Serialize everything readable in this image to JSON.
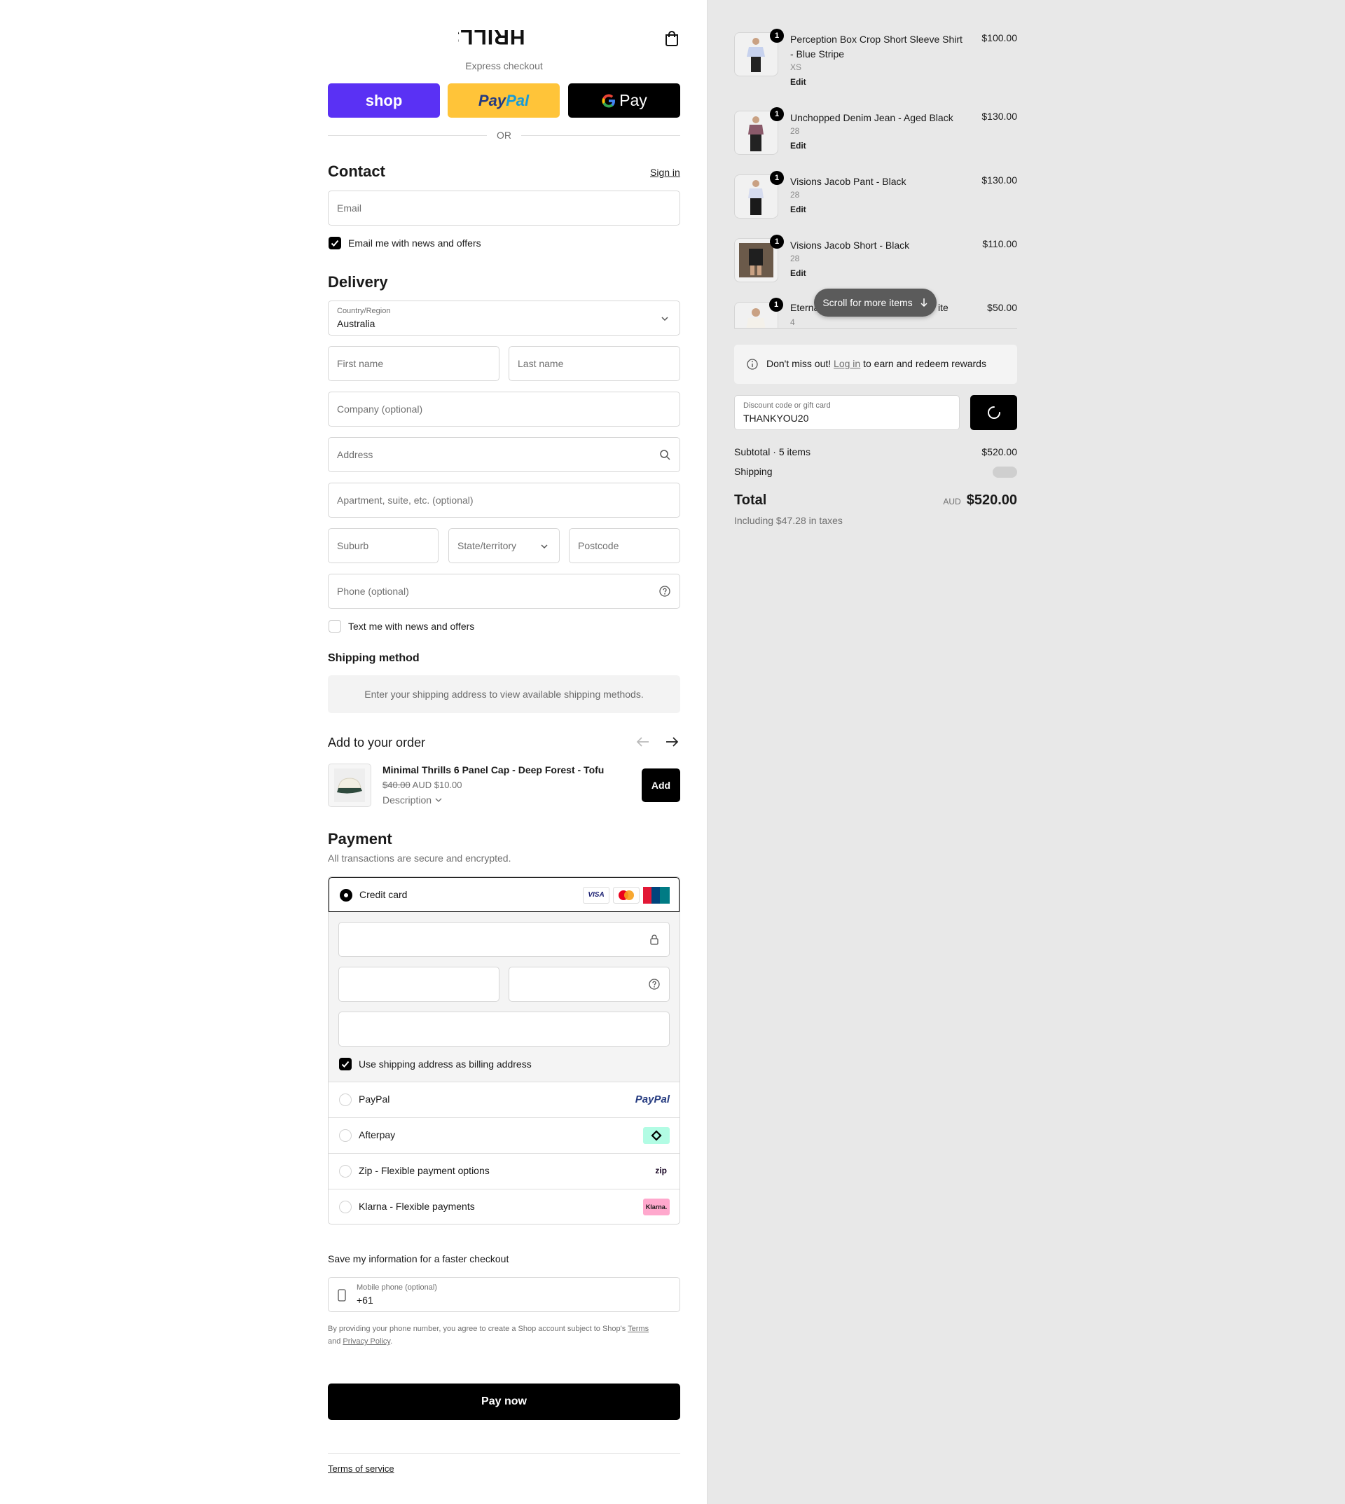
{
  "brand": {
    "logo_text": "THRILLS"
  },
  "express": {
    "label": "Express checkout",
    "shop_label": "shop",
    "paypal_label_a": "Pay",
    "paypal_label_b": "Pal",
    "gpay_label": "Pay",
    "or_label": "OR"
  },
  "contact": {
    "heading": "Contact",
    "signin": "Sign in",
    "email_placeholder": "Email",
    "newsletter_label": "Email me with news and offers",
    "newsletter_checked": true
  },
  "delivery": {
    "heading": "Delivery",
    "country_label": "Country/Region",
    "country_value": "Australia",
    "first_name": "First name",
    "last_name": "Last name",
    "company": "Company (optional)",
    "address": "Address",
    "apartment": "Apartment, suite, etc. (optional)",
    "suburb": "Suburb",
    "state": "State/territory",
    "postcode": "Postcode",
    "phone": "Phone (optional)",
    "sms_label": "Text me with news and offers",
    "sms_checked": false
  },
  "shipping": {
    "heading": "Shipping method",
    "notice": "Enter your shipping address to view available shipping methods."
  },
  "upsell": {
    "heading": "Add to your order",
    "product_name": "Minimal Thrills 6 Panel Cap - Deep Forest - Tofu",
    "old_price": "$40.00",
    "new_price": "AUD $10.00",
    "description_label": "Description",
    "add_label": "Add"
  },
  "payment": {
    "heading": "Payment",
    "subheading": "All transactions are secure and encrypted.",
    "credit_card_label": "Credit card",
    "card_brands": [
      "VISA",
      "Mastercard",
      "UnionPay"
    ],
    "billing_label": "Use shipping address as billing address",
    "billing_checked": true,
    "methods": [
      {
        "label": "PayPal",
        "badge": "PayPal"
      },
      {
        "label": "Afterpay",
        "badge": "afterpay"
      },
      {
        "label": "Zip - Flexible payment options",
        "badge": "zip"
      },
      {
        "label": "Klarna - Flexible payments",
        "badge": "Klarna."
      }
    ]
  },
  "save_info": {
    "heading": "Save my information for a faster checkout",
    "phone_label": "Mobile phone (optional)",
    "phone_value": "+61",
    "legal_a": "By providing your phone number, you agree to create a Shop account subject to Shop's",
    "legal_terms": "Terms",
    "legal_and": "and",
    "legal_privacy": "Privacy Policy",
    "legal_end": "."
  },
  "pay_now": "Pay now",
  "footer": {
    "terms": "Terms of service"
  },
  "summary": {
    "items": [
      {
        "qty": "1",
        "name": "Perception Box Crop Short Sleeve Shirt - Blue Stripe",
        "variant": "XS",
        "edit": "Edit",
        "price": "$100.00"
      },
      {
        "qty": "1",
        "name": "Unchopped Denim Jean - Aged Black",
        "variant": "28",
        "edit": "Edit",
        "price": "$130.00"
      },
      {
        "qty": "1",
        "name": "Visions Jacob Pant - Black",
        "variant": "28",
        "edit": "Edit",
        "price": "$130.00"
      },
      {
        "qty": "1",
        "name": "Visions Jacob Short - Black",
        "variant": "28",
        "edit": "Edit",
        "price": "$110.00"
      },
      {
        "qty": "1",
        "name_a": "Eterna",
        "name_b": "ite",
        "variant": "4",
        "price": "$50.00"
      }
    ],
    "scroll_pill": "Scroll for more items",
    "rewards_a": "Don't miss out!",
    "rewards_link": "Log in",
    "rewards_b": "to earn and redeem rewards",
    "discount_label": "Discount code or gift card",
    "discount_value": "THANKYOU20",
    "subtotal_label": "Subtotal · 5 items",
    "subtotal_value": "$520.00",
    "shipping_label": "Shipping",
    "total_label": "Total",
    "total_currency": "AUD",
    "total_value": "$520.00",
    "tax_note": "Including $47.28 in taxes"
  },
  "colors": {
    "shop_purple": "#5a31f4",
    "paypal_yellow": "#ffc439",
    "summary_bg": "#e8e8e8",
    "afterpay_mint": "#b2fce4",
    "klarna_pink": "#ffa8cd"
  }
}
